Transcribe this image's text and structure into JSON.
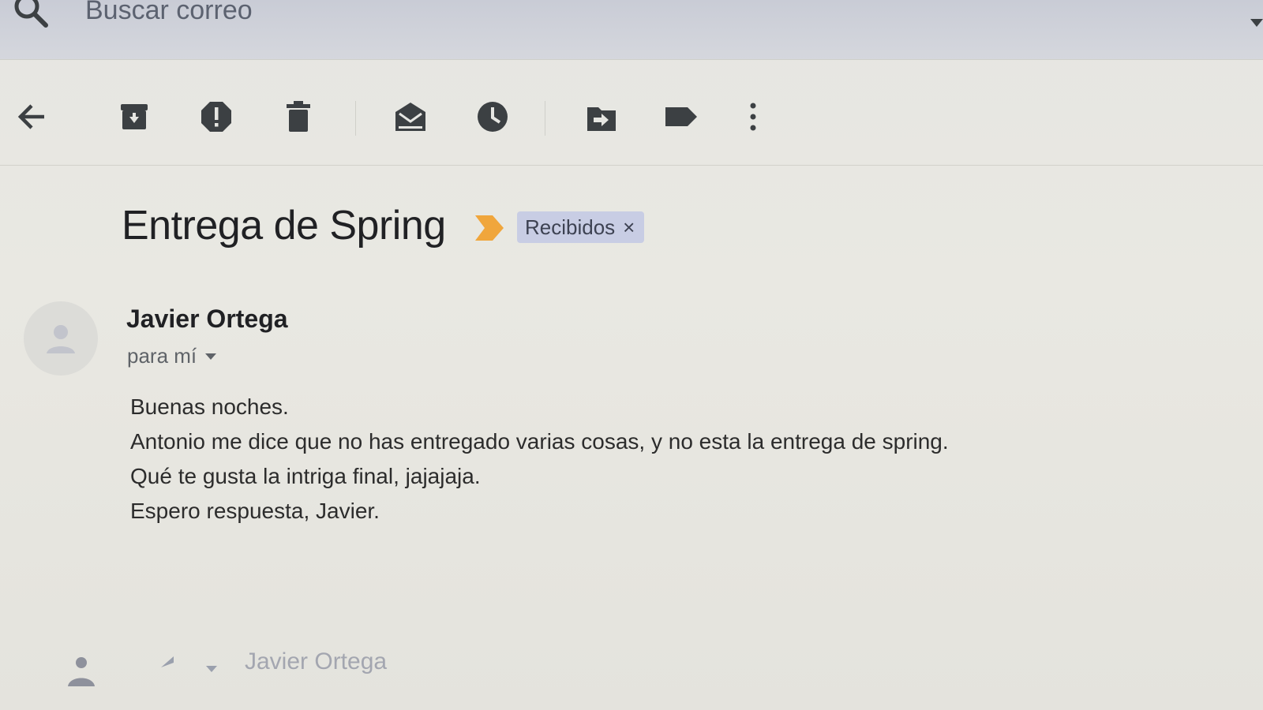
{
  "search": {
    "placeholder": "Buscar correo",
    "icon": "search-icon"
  },
  "toolbar": {
    "items": [
      {
        "name": "back",
        "icon": "arrow-left-icon"
      },
      {
        "name": "archive",
        "icon": "archive-icon"
      },
      {
        "name": "report-spam",
        "icon": "report-icon"
      },
      {
        "name": "delete",
        "icon": "trash-icon"
      },
      {
        "name": "mark-unread",
        "icon": "mark-unread-icon"
      },
      {
        "name": "snooze",
        "icon": "clock-icon"
      },
      {
        "name": "move-to",
        "icon": "move-to-icon"
      },
      {
        "name": "labels",
        "icon": "label-icon"
      },
      {
        "name": "more",
        "icon": "more-vert-icon"
      }
    ]
  },
  "message": {
    "subject": "Entrega de Spring",
    "label": "Recibidos",
    "label_close": "×",
    "sender": "Javier Ortega",
    "recipient": "para mí",
    "body": [
      "Buenas noches.",
      "Antonio me dice que no has entregado varias cosas, y no esta la entrega de spring.",
      "Qué te gusta la intriga final, jajajaja.",
      "Espero respuesta, Javier."
    ]
  },
  "reply": {
    "recipient": "Javier Ortega"
  },
  "colors": {
    "icon": "#3c4043",
    "importance": "#f0a63c",
    "label_chip_bg": "#c8cde4",
    "header_bg": "#c9ccd6"
  }
}
